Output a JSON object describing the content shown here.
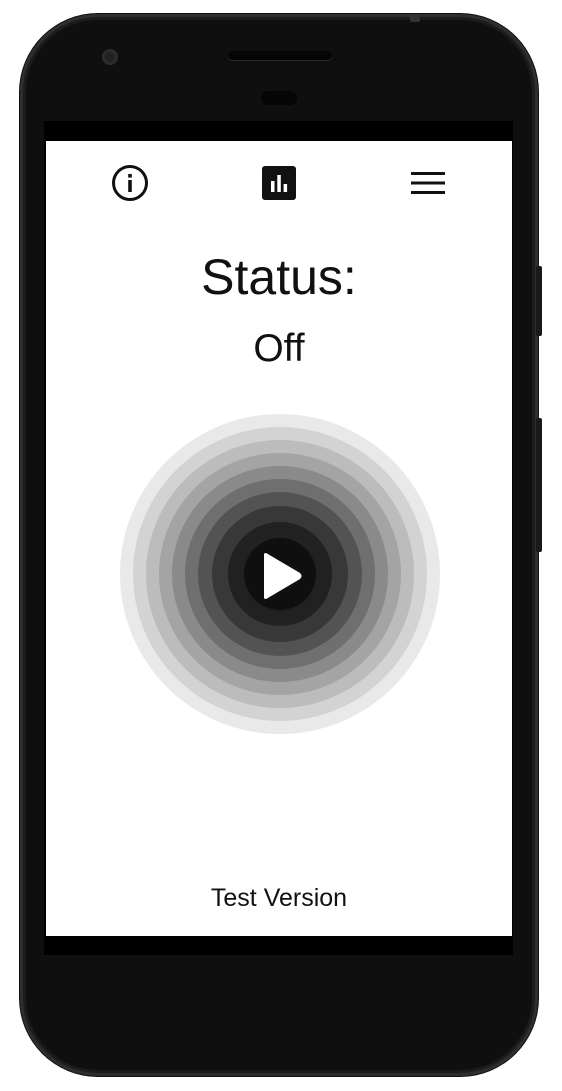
{
  "header": {
    "info_icon": "info-icon",
    "stats_icon": "bar-chart-icon",
    "menu_icon": "hamburger-menu-icon"
  },
  "status": {
    "title": "Status:",
    "value": "Off"
  },
  "control": {
    "icon": "play-icon",
    "ring_colors": [
      "#e9e9e9",
      "#d3d3d3",
      "#bcbcbc",
      "#a4a4a4",
      "#8a8a8a",
      "#6f6f6f",
      "#535353",
      "#383838",
      "#212121",
      "#0f0f0f"
    ]
  },
  "footer": {
    "text": "Test Version"
  }
}
